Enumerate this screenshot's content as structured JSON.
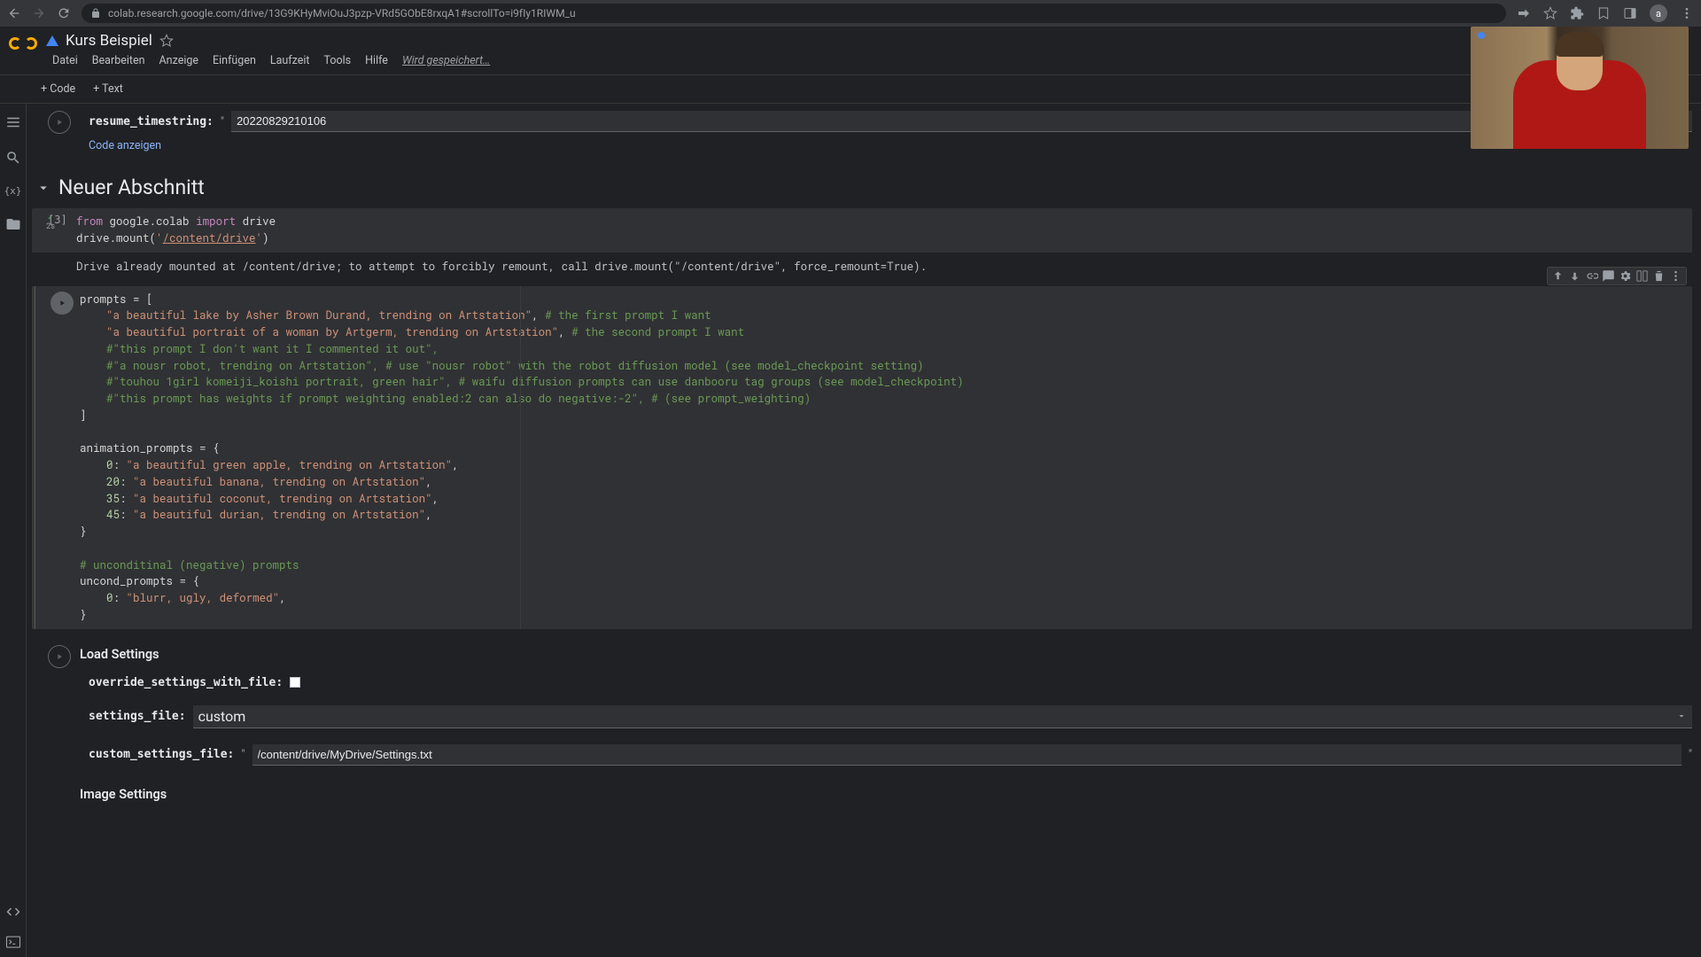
{
  "browser": {
    "url": "colab.research.google.com/drive/13G9KHyMviOuJ3pzp-VRd5GObE8rxqA1#scrollTo=i9fIy1RIWM_u",
    "avatar_letter": "a"
  },
  "header": {
    "title": "Kurs Beispiel",
    "menu": {
      "file": "Datei",
      "edit": "Bearbeiten",
      "view": "Anzeige",
      "insert": "Einfügen",
      "runtime": "Laufzeit",
      "tools": "Tools",
      "help": "Hilfe",
      "saving": "Wird gespeichert…"
    }
  },
  "toolbar": {
    "code_btn": "+ Code",
    "text_btn": "+ Text"
  },
  "top_form": {
    "label": "resume_timestring:",
    "value": "20220829210106",
    "show_code": "Code anzeigen"
  },
  "section_title": "Neuer Abschnitt",
  "drive_cell": {
    "exec_count": "[3]",
    "output": "Drive already mounted at /content/drive; to attempt to forcibly remount, call drive.mount(\"/content/drive\", force_remount=True)."
  },
  "load_settings": {
    "heading": "Load Settings",
    "override_label": "override_settings_with_file:",
    "settings_file_label": "settings_file:",
    "settings_file_value": "custom",
    "custom_file_label": "custom_settings_file:",
    "custom_file_value": "/content/drive/MyDrive/Settings.txt",
    "image_settings": "Image Settings"
  }
}
